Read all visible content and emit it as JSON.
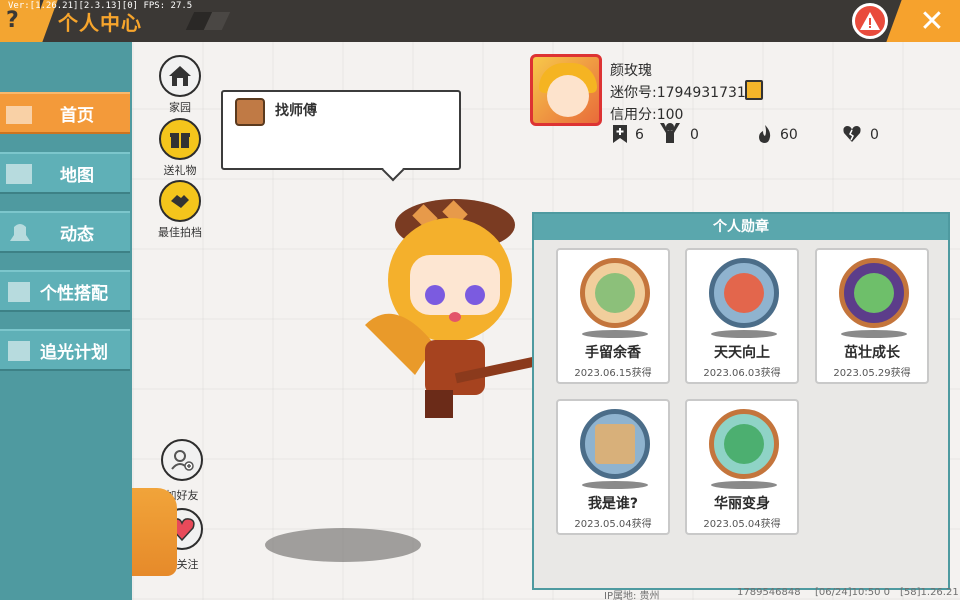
{
  "topbar": {
    "version": "Ver:[1.26.21][2.3.13][0] FPS: 27.5",
    "title": "个人中心"
  },
  "sidebar": {
    "items": [
      {
        "label": "首页",
        "active": true
      },
      {
        "label": "地图",
        "active": false
      },
      {
        "label": "动态",
        "active": false
      },
      {
        "label": "个性搭配",
        "active": false
      },
      {
        "label": "追光计划",
        "active": false
      }
    ]
  },
  "actions": {
    "home": "家园",
    "gift": "送礼物",
    "best_photo": "最佳拍档",
    "add_friend": "加好友",
    "follow": "加关注"
  },
  "speech": {
    "text": "找师傅"
  },
  "profile": {
    "name": "颜玫瑰",
    "mini_id": "迷你号:1794931731",
    "credit": "信用分:100",
    "stats": [
      {
        "icon": "plus-bookmark-icon",
        "value": "6"
      },
      {
        "icon": "cheer-icon",
        "value": "0"
      },
      {
        "icon": "flame-icon",
        "value": "60"
      },
      {
        "icon": "broken-heart-icon",
        "value": "0"
      }
    ]
  },
  "medals": {
    "title": "个人勋章",
    "items": [
      {
        "name": "手留余香",
        "date": "2023.06.15获得",
        "style": "bronze"
      },
      {
        "name": "天天向上",
        "date": "2023.06.03获得",
        "style": "blue"
      },
      {
        "name": "茁壮成长",
        "date": "2023.05.29获得",
        "style": "bronze"
      },
      {
        "name": "我是谁?",
        "date": "2023.05.04获得",
        "style": "blue"
      },
      {
        "name": "华丽变身",
        "date": "2023.05.04获得",
        "style": "bronze"
      }
    ]
  },
  "footer": {
    "ip": "IP属地: 贵州",
    "uid": "1789546848",
    "time": "[06/24]10:50 0",
    "build": "[58]1.26.21"
  }
}
